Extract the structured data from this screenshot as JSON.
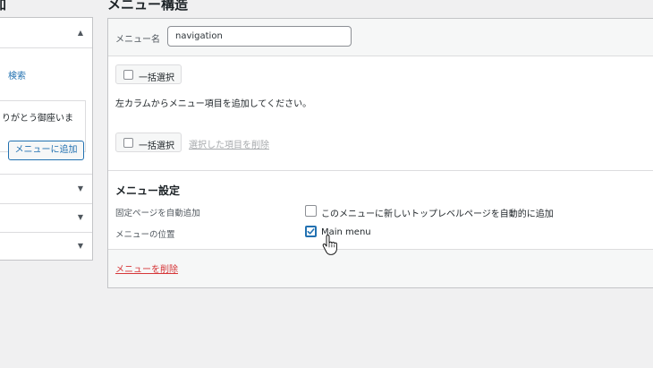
{
  "left": {
    "heading": "加",
    "search_link": "検索",
    "snippet_text": "りがとう御座いま",
    "add_button": "メニューに追加"
  },
  "main": {
    "heading": "メニュー構造",
    "menu_name_label": "メニュー名",
    "menu_name_value": "navigation",
    "bulk_select_label": "一括選択",
    "instruction": "左カラムからメニュー項目を追加してください。",
    "delete_selected": "選択した項目を削除",
    "settings": {
      "title": "メニュー設定",
      "auto_add_label": "固定ページを自動追加",
      "auto_add_option": "このメニューに新しいトップレベルページを自動的に追加",
      "location_label": "メニューの位置",
      "location_option": "Main menu"
    },
    "delete_menu": "メニューを削除"
  },
  "colors": {
    "accent": "#2271b1",
    "danger": "#d63638"
  }
}
